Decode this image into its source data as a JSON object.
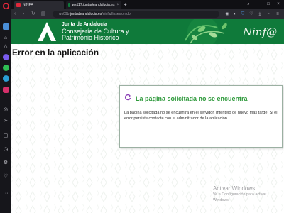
{
  "browser": {
    "tabs": [
      {
        "label": "NINFA",
        "active": true
      },
      {
        "label": "ws117.juntadeandalucia.es",
        "active": false
      }
    ],
    "address": {
      "prefix": "ws09b.",
      "host": "juntadeandalucia.es",
      "path": "/ninfa/finsesion.do"
    },
    "sidebar_icons": [
      "opera-icon",
      "speed-dial-icon",
      "home-icon",
      "aria-icon",
      "messenger-icon",
      "whatsapp-icon",
      "telegram-icon",
      "instagram-icon",
      "player-icon",
      "send-icon",
      "pinboard-icon",
      "history-icon",
      "settings-icon",
      "heart-icon",
      "more-icon"
    ]
  },
  "header": {
    "org_line": "Junta de Andalucía",
    "dept_line1": "Consejería de Cultura y",
    "dept_line2": "Patrimonio Histórico",
    "app_logo": "Ninf@"
  },
  "page": {
    "title": "Error en la aplicación"
  },
  "error_panel": {
    "title": "La página solicitada no se encuentra",
    "body": "La página solicitada no se encuentra en el servidor. Intentelo de nuevo más tarde. Si el error persiste contacte con el adminitrador de la aplicación.",
    "icon": "refresh-icon"
  },
  "watermark": {
    "line1": "Activar Windows",
    "line2": "Ve a Configuración para activar",
    "line3": "Windows."
  },
  "colors": {
    "header_green": "#0f7a3a",
    "panel_title_green": "#2f9a3c",
    "browser_dark": "#1e1e24"
  }
}
